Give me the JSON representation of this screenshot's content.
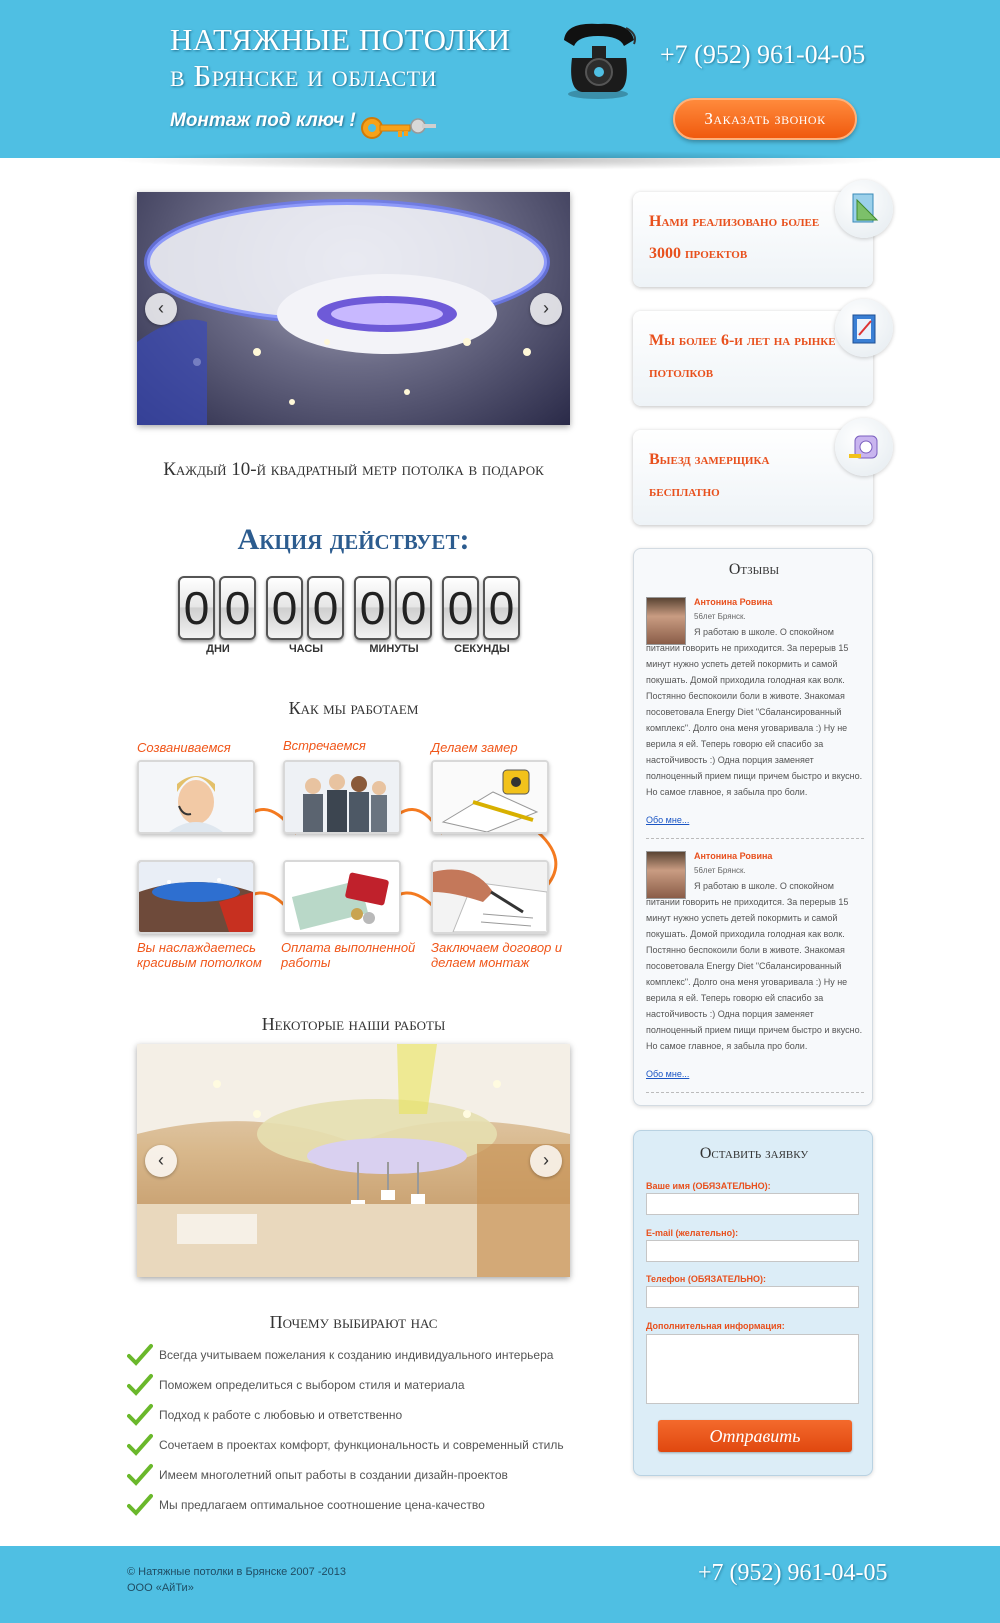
{
  "header": {
    "title_line1": "НАТЯЖНЫЕ ПОТОЛКИ",
    "title_line2": "в Брянске и области",
    "subtitle": "Монтаж под ключ !",
    "phone": "+7 (952) 961-04-05",
    "call_button": "Заказать звонок",
    "icons": [
      "phone-icon",
      "key-icon"
    ],
    "colors": {
      "header_bg": "#4fbfe3",
      "accent": "#f05a0e"
    }
  },
  "promo": {
    "text": "Каждый 10-й квадратный метр потолка в подарок",
    "action": "Акция действует:",
    "timer": [
      {
        "value": "00",
        "label": "ДНИ"
      },
      {
        "value": "00",
        "label": "ЧАСЫ"
      },
      {
        "value": "00",
        "label": "МИНУТЫ"
      },
      {
        "value": "00",
        "label": "СЕКУНДЫ"
      }
    ]
  },
  "how_we_work": {
    "title": "Как мы работаем",
    "steps": [
      {
        "label": "Созваниваемся"
      },
      {
        "label": "Встречаемся"
      },
      {
        "label": "Делаем замер"
      },
      {
        "label": "Вы наслаждаетесь красивым потолком"
      },
      {
        "label": "Оплата выполненной работы"
      },
      {
        "label": "Заключаем договор и делаем монтаж"
      }
    ]
  },
  "works": {
    "title": "Некоторые наши работы"
  },
  "why_us": {
    "title": "Почему выбирают нас",
    "items": [
      "Всегда учитываем пожелания к созданию индивидуального интерьера",
      "Поможем определиться с выбором стиля и материала",
      "Подход к работе с любовью и ответственно",
      "Сочетаем в проектах комфорт, функциональность и современный стиль",
      "Имеем многолетний опыт работы в создании дизайн-проектов",
      "Мы предлагаем оптимальное соотношение цена-качество"
    ]
  },
  "features": [
    {
      "text": "Нами реализовано более 3000 проектов",
      "icon": "drafting-icon"
    },
    {
      "text": "Мы более 6-и лет на рынке потолков",
      "icon": "notepad-icon"
    },
    {
      "text": "Выезд замерщика бесплатно",
      "icon": "tape-measure-icon"
    }
  ],
  "reviews": {
    "title": "Отзывы",
    "items": [
      {
        "name": "Антонина Ровина",
        "meta": "56лет Брянск.",
        "text": "Я работаю в школе. О спокойном питании говорить не приходится. За перерыв 15 минут нужно успеть детей покормить и самой покушать. Домой приходила голодная как волк. Постянно беспокоили боли в животе. Знакомая посоветовала Energy Diet \"Сбалансированный комплекс\". Долго она меня уговаривала :) Ну не верила я ей. Теперь говорю ей спасибо за настойчивость :) Одна порция заменяет полноценный прием пищи причем быстро и вкусно. Но самое главное, я забыла про боли.",
        "link": "Обо мне..."
      },
      {
        "name": "Антонина Ровина",
        "meta": "56лет Брянск.",
        "text": "Я работаю в школе. О спокойном питании говорить не приходится. За перерыв 15 минут нужно успеть детей покормить и самой покушать. Домой приходила голодная как волк. Постянно беспокоили боли в животе. Знакомая посоветовала Energy Diet \"Сбалансированный комплекс\". Долго она меня уговаривала :) Ну не верила я ей. Теперь говорю ей спасибо за настойчивость :) Одна порция заменяет полноценный прием пищи причем быстро и вкусно. Но самое главное, я забыла про боли.",
        "link": "Обо мне..."
      }
    ]
  },
  "form": {
    "title": "Оставить заявку",
    "name_label": "Ваше имя (ОБЯЗАТЕЛЬНО):",
    "name_value": "",
    "email_label": "E-mail (желательно):",
    "email_value": "",
    "phone_label": "Телефон (ОБЯЗАТЕЛЬНО):",
    "phone_value": "",
    "info_label": "Дополнительная информация:",
    "info_value": "",
    "submit": "Отправить"
  },
  "footer": {
    "copyright": "© Натяжные потолки в Брянске 2007 -2013",
    "company": "ООО «АйТи»",
    "phone": "+7 (952) 961-04-05"
  }
}
